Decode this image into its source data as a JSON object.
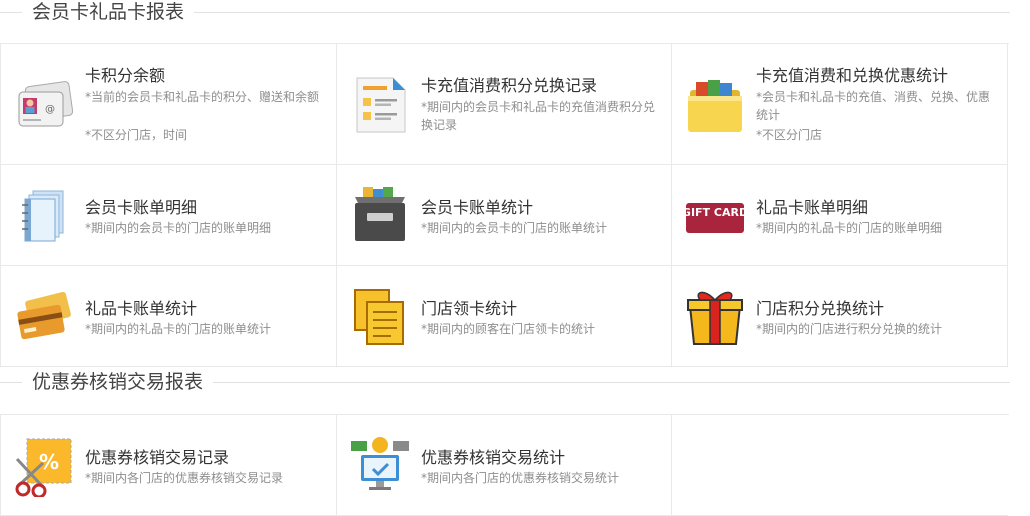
{
  "sections": [
    {
      "title": "会员卡礼品卡报表",
      "cards": [
        {
          "title": "卡积分余额",
          "desc": "*当前的会员卡和礼品卡的积分、赠送和余额",
          "desc2": "*不区分门店，时间",
          "icon": "address-card-icon"
        },
        {
          "title": "卡充值消费积分兑换记录",
          "desc": "*期间内的会员卡和礼品卡的充值消费积分兑换记录",
          "desc2": "",
          "icon": "document-list-icon"
        },
        {
          "title": "卡充值消费和兑换优惠统计",
          "desc": "*会员卡和礼品卡的充值、消费、兑换、优惠统计",
          "desc2": "*不区分门店",
          "icon": "folder-icon"
        },
        {
          "title": "会员卡账单明细",
          "desc": "*期间内的会员卡的门店的账单明细",
          "desc2": "",
          "icon": "notebook-icon"
        },
        {
          "title": "会员卡账单统计",
          "desc": "*期间内的会员卡的门店的账单统计",
          "desc2": "",
          "icon": "file-cabinet-icon"
        },
        {
          "title": "礼品卡账单明细",
          "desc": "*期间内的礼品卡的门店的账单明细",
          "desc2": "",
          "icon": "gift-card-icon"
        },
        {
          "title": "礼品卡账单统计",
          "desc": "*期间内的礼品卡的门店的账单统计",
          "desc2": "",
          "icon": "credit-cards-icon"
        },
        {
          "title": "门店领卡统计",
          "desc": "*期间内的顾客在门店领卡的统计",
          "desc2": "",
          "icon": "documents-icon"
        },
        {
          "title": "门店积分兑换统计",
          "desc": "*期间内的门店进行积分兑换的统计",
          "desc2": "",
          "icon": "gift-box-icon"
        }
      ]
    },
    {
      "title": "优惠券核销交易报表",
      "cards": [
        {
          "title": "优惠券核销交易记录",
          "desc": "*期间内各门店的优惠券核销交易记录",
          "desc2": "",
          "icon": "coupon-scissors-icon"
        },
        {
          "title": "优惠券核销交易统计",
          "desc": "*期间内各门店的优惠券核销交易统计",
          "desc2": "",
          "icon": "payment-monitor-icon"
        }
      ]
    }
  ],
  "gift_card_text": "GIFT CARD"
}
